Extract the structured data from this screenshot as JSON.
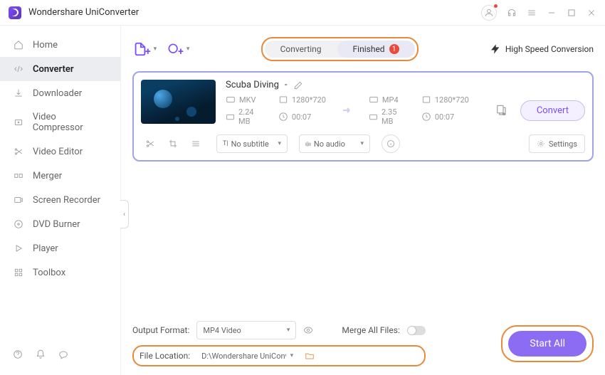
{
  "app_title": "Wondershare UniConverter",
  "sidebar": {
    "items": [
      {
        "label": "Home"
      },
      {
        "label": "Converter"
      },
      {
        "label": "Downloader"
      },
      {
        "label": "Video Compressor"
      },
      {
        "label": "Video Editor"
      },
      {
        "label": "Merger"
      },
      {
        "label": "Screen Recorder"
      },
      {
        "label": "DVD Burner"
      },
      {
        "label": "Player"
      },
      {
        "label": "Toolbox"
      }
    ]
  },
  "tabs": {
    "converting": "Converting",
    "finished": "Finished",
    "finished_count": "1"
  },
  "high_speed": "High Speed Conversion",
  "file": {
    "title": "Scuba Diving",
    "sep": "-",
    "in_format": "MKV",
    "in_res": "1280*720",
    "in_size": "2.24 MB",
    "in_dur": "00:07",
    "out_format": "MP4",
    "out_res": "1280*720",
    "out_size": "2.35 MB",
    "out_dur": "00:07",
    "convert": "Convert",
    "subtitle_sel": "No subtitle",
    "audio_sel": "No audio",
    "settings": "Settings"
  },
  "footer": {
    "output_format_label": "Output Format:",
    "output_format_value": "MP4 Video",
    "file_location_label": "File Location:",
    "file_location_value": "D:\\Wondershare UniConverter",
    "merge_label": "Merge All Files:",
    "start": "Start All"
  }
}
